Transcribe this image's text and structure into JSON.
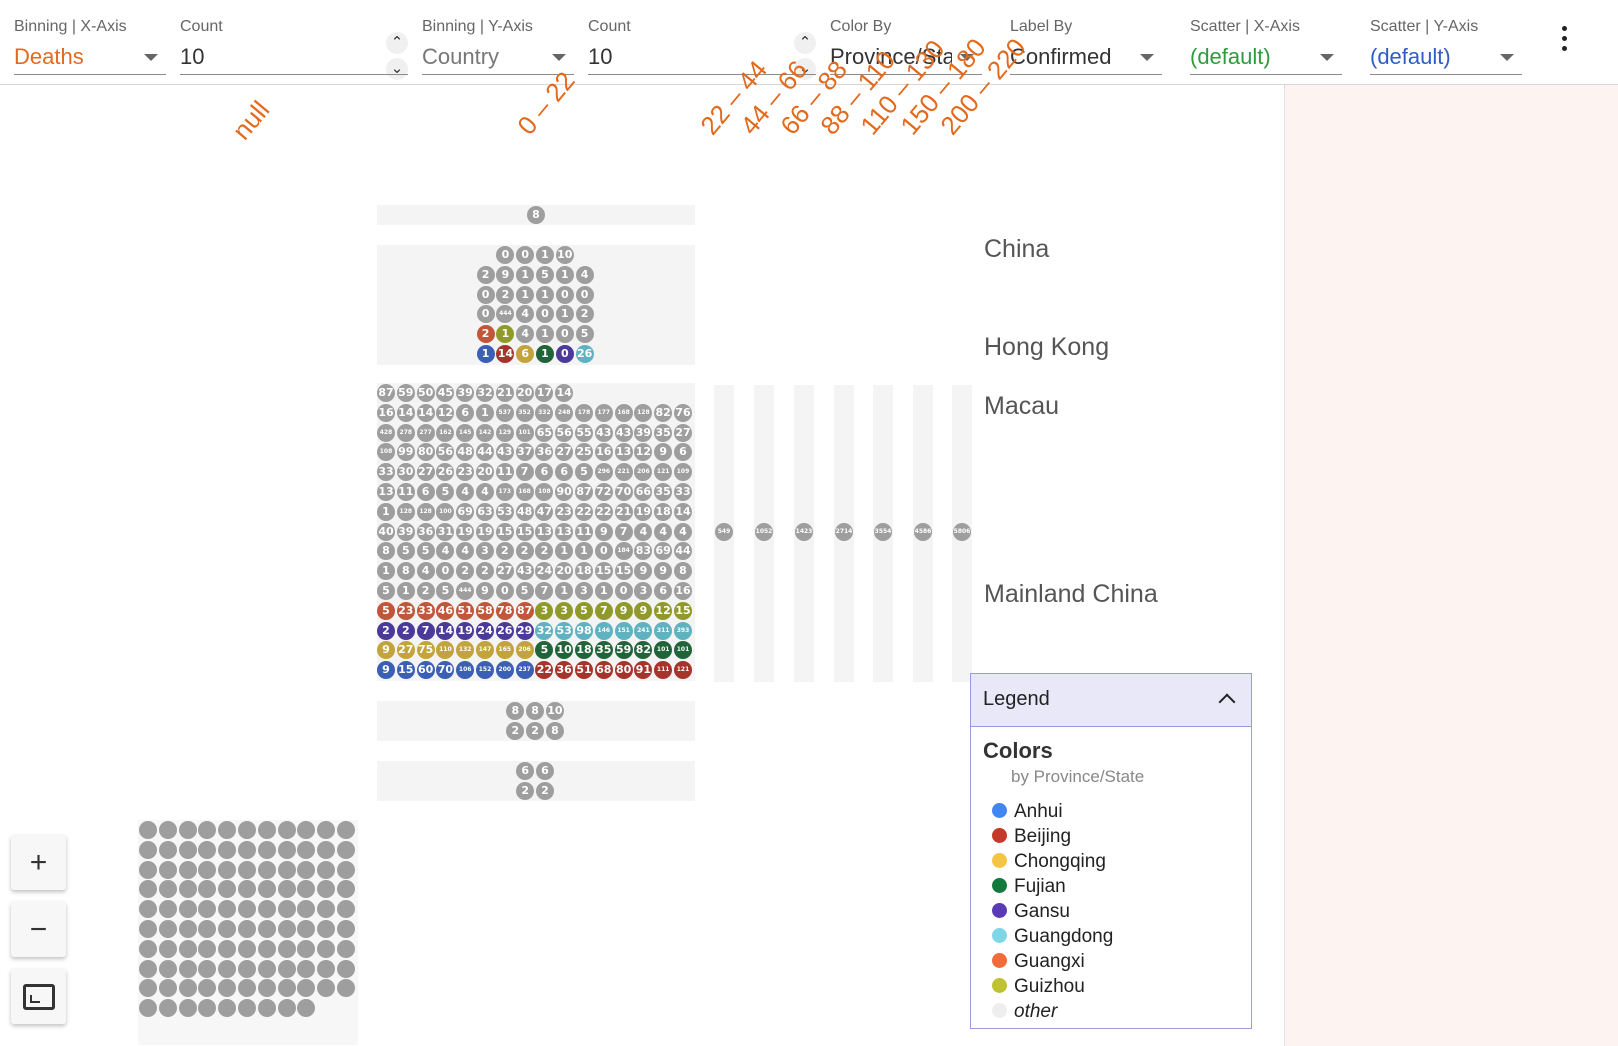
{
  "toolbar": {
    "binning_x": {
      "label": "Binning | X-Axis",
      "value": "Deaths",
      "color": "#e36a1c"
    },
    "count_x": {
      "label": "Count",
      "value": "10"
    },
    "binning_y": {
      "label": "Binning | Y-Axis",
      "value": "Country",
      "color": "#777777"
    },
    "count_y": {
      "label": "Count",
      "value": "10"
    },
    "color_by": {
      "label": "Color By",
      "value": "Province/State"
    },
    "label_by": {
      "label": "Label By",
      "value": "Confirmed"
    },
    "scatter_x": {
      "label": "Scatter | X-Axis",
      "value": "(default)",
      "color": "#2e9b3d"
    },
    "scatter_y": {
      "label": "Scatter | Y-Axis",
      "value": "(default)",
      "color": "#2f5cc7"
    },
    "menu_icon": "vertical-dots-icon"
  },
  "column_labels": [
    "null",
    "0 – 22",
    "22 – 44",
    "44 – 66",
    "66 – 88",
    "88 – 110",
    "110 – 130",
    "150 – 180",
    "200 – 220"
  ],
  "row_labels": [
    "China",
    "Hong Kong",
    "Macau",
    "Mainland China"
  ],
  "cells": {
    "top": [
      "8"
    ],
    "china": [
      [
        "0",
        "0",
        "1",
        "10"
      ],
      [
        "2",
        "9",
        "1",
        "5",
        "1",
        "4"
      ],
      [
        "0",
        "2",
        "1",
        "1",
        "0",
        "0"
      ],
      [
        "0",
        "444",
        "4",
        "0",
        "1",
        "2"
      ],
      [
        "2",
        "1",
        "4",
        "1",
        "0",
        "5"
      ],
      [
        "1",
        "14",
        "6",
        "1",
        "0",
        "26"
      ]
    ],
    "china_colors": [
      [
        "g",
        "g",
        "g",
        "g"
      ],
      [
        "g",
        "g",
        "g",
        "g",
        "g",
        "g"
      ],
      [
        "g",
        "g",
        "g",
        "g",
        "g",
        "g"
      ],
      [
        "g",
        "g",
        "g",
        "g",
        "g",
        "g"
      ],
      [
        "red",
        "olive",
        "g",
        "g",
        "g",
        "g"
      ],
      [
        "blue",
        "dred",
        "gold",
        "green",
        "purple",
        "teal"
      ]
    ],
    "mainland": [
      [
        "87",
        "59",
        "50",
        "45",
        "39",
        "32",
        "21",
        "20",
        "17",
        "14"
      ],
      [
        "16",
        "14",
        "14",
        "12",
        "6",
        "1",
        "537",
        "352",
        "332",
        "248",
        "178",
        "177",
        "168",
        "128",
        "82",
        "76"
      ],
      [
        "428",
        "278",
        "277",
        "162",
        "145",
        "142",
        "129",
        "101",
        "65",
        "56",
        "55",
        "43",
        "43",
        "39",
        "35",
        "27"
      ],
      [
        "108",
        "99",
        "80",
        "56",
        "48",
        "44",
        "43",
        "37",
        "36",
        "27",
        "25",
        "16",
        "13",
        "12",
        "9",
        "6"
      ],
      [
        "33",
        "30",
        "27",
        "26",
        "23",
        "20",
        "11",
        "7",
        "6",
        "6",
        "5",
        "296",
        "221",
        "206",
        "121",
        "109"
      ],
      [
        "13",
        "11",
        "6",
        "5",
        "4",
        "4",
        "173",
        "168",
        "108",
        "90",
        "87",
        "72",
        "70",
        "66",
        "35",
        "33"
      ],
      [
        "1",
        "128",
        "128",
        "100",
        "69",
        "63",
        "53",
        "48",
        "47",
        "23",
        "22",
        "22",
        "21",
        "19",
        "18",
        "14"
      ],
      [
        "40",
        "39",
        "36",
        "31",
        "19",
        "19",
        "15",
        "15",
        "13",
        "13",
        "11",
        "9",
        "7",
        "4",
        "4",
        "4"
      ],
      [
        "8",
        "5",
        "5",
        "4",
        "4",
        "3",
        "2",
        "2",
        "2",
        "1",
        "1",
        "0",
        "184",
        "83",
        "69",
        "44"
      ],
      [
        "1",
        "8",
        "4",
        "0",
        "2",
        "2",
        "27",
        "43",
        "24",
        "20",
        "18",
        "15",
        "15",
        "9",
        "9",
        "8"
      ],
      [
        "5",
        "1",
        "2",
        "5",
        "444",
        "9",
        "0",
        "5",
        "7",
        "1",
        "3",
        "1",
        "0",
        "3",
        "6",
        "16"
      ],
      [
        "5",
        "23",
        "33",
        "46",
        "51",
        "58",
        "78",
        "87",
        "3",
        "3",
        "5",
        "7",
        "9",
        "9",
        "12",
        "15"
      ],
      [
        "2",
        "2",
        "7",
        "14",
        "19",
        "24",
        "26",
        "29",
        "32",
        "53",
        "98",
        "146",
        "151",
        "241",
        "311",
        "393"
      ],
      [
        "9",
        "27",
        "75",
        "110",
        "132",
        "147",
        "165",
        "206",
        "5",
        "10",
        "18",
        "35",
        "59",
        "82",
        "101",
        "101"
      ],
      [
        "9",
        "15",
        "60",
        "70",
        "106",
        "152",
        "200",
        "237",
        "22",
        "36",
        "51",
        "68",
        "80",
        "91",
        "111",
        "121"
      ]
    ],
    "mainland_color_rows": [
      [
        "g"
      ],
      [
        "g"
      ],
      [
        "g"
      ],
      [
        "g"
      ],
      [
        "g"
      ],
      [
        "g"
      ],
      [
        "g"
      ],
      [
        "g"
      ],
      [
        "g"
      ],
      [
        "g"
      ],
      [
        "g"
      ],
      [
        "red",
        "red",
        "red",
        "red",
        "red",
        "red",
        "red",
        "red",
        "olive",
        "olive",
        "olive",
        "olive",
        "olive",
        "olive",
        "olive",
        "olive"
      ],
      [
        "purple",
        "purple",
        "purple",
        "purple",
        "purple",
        "purple",
        "purple",
        "purple",
        "teal",
        "teal",
        "teal",
        "teal",
        "teal",
        "teal",
        "teal",
        "teal"
      ],
      [
        "gold",
        "gold",
        "gold",
        "gold",
        "gold",
        "gold",
        "gold",
        "gold",
        "green",
        "green",
        "green",
        "green",
        "green",
        "green",
        "green",
        "green"
      ],
      [
        "blue",
        "blue",
        "blue",
        "blue",
        "blue",
        "blue",
        "blue",
        "blue",
        "dred",
        "dred",
        "dred",
        "dred",
        "dred",
        "dred",
        "dred",
        "dred"
      ]
    ],
    "mainland_other_cols": [
      "549",
      "1052",
      "1423",
      "2714",
      "3554",
      "4586",
      "5806"
    ],
    "row5": [
      [
        "8",
        "8",
        "10"
      ],
      [
        "2",
        "2",
        "8"
      ]
    ],
    "row6": [
      [
        "6",
        "6"
      ],
      [
        "2",
        "2"
      ]
    ],
    "null_grid_count": 108
  },
  "zoom": {
    "in_icon": "zoom-in-plus-icon",
    "out_icon": "zoom-out-minus-icon",
    "fit_icon": "fit-to-screen-icon",
    "in_glyph": "+",
    "out_glyph": "−"
  },
  "legend": {
    "title": "Legend",
    "section": "Colors",
    "subtitle": "by Province/State",
    "items": [
      {
        "label": "Anhui",
        "color": "#4285f4"
      },
      {
        "label": "Beijing",
        "color": "#c5392a"
      },
      {
        "label": "Chongqing",
        "color": "#f6c445"
      },
      {
        "label": "Fujian",
        "color": "#137a3e"
      },
      {
        "label": "Gansu",
        "color": "#5b3bb5"
      },
      {
        "label": "Guangdong",
        "color": "#7fd6e6"
      },
      {
        "label": "Guangxi",
        "color": "#f26b3a"
      },
      {
        "label": "Guizhou",
        "color": "#c0c233"
      },
      {
        "label": "other",
        "color": "#eeeeee"
      }
    ]
  },
  "dot_colors": {
    "g": "#9e9e9e",
    "red": "#c0573a",
    "olive": "#8f9a2a",
    "blue": "#3b5fb5",
    "dred": "#a5352c",
    "gold": "#c3a33c",
    "green": "#21643a",
    "purple": "#4b3a9a",
    "teal": "#5fb3c0"
  }
}
